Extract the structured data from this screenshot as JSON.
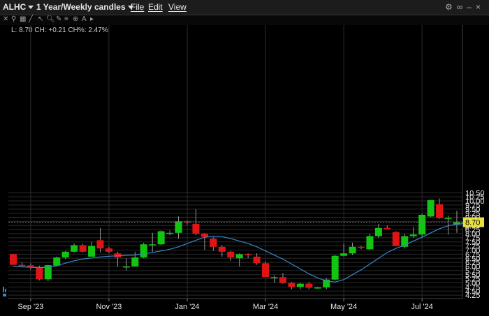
{
  "window": {
    "symbol": "ALHC",
    "period": "1 Year/Weekly candles",
    "menus": [
      "File",
      "Edit",
      "View"
    ]
  },
  "info_line": "L: 8.70 CH: +0.21 CH%: 2.47%",
  "colors": {
    "up": "#11c511",
    "down": "#e01414",
    "ma": "#3a86c8",
    "grid": "#2b2b2b",
    "last_price_bg": "#e8e03c"
  },
  "icons": [
    "settings-icon",
    "link-icon",
    "minimize-icon",
    "close-icon"
  ],
  "chart_data": {
    "type": "candlestick",
    "last_price_label": "8.70",
    "y_ticks": [
      "10.50",
      "10.25",
      "10.00",
      "9.75",
      "9.50",
      "9.25",
      "9.00",
      "8.75",
      "8.50",
      "8.25",
      "8.00",
      "7.75",
      "7.50",
      "7.25",
      "7.00",
      "6.75",
      "6.50",
      "6.25",
      "6.00",
      "5.75",
      "5.50",
      "5.25",
      "5.00",
      "4.75",
      "4.50",
      "4.25"
    ],
    "ylim": [
      4.0,
      10.6
    ],
    "x_labels": [
      {
        "label": "Sep '23",
        "week": 2
      },
      {
        "label": "Nov '23",
        "week": 11
      },
      {
        "label": "Jan '24",
        "week": 20
      },
      {
        "label": "Mar '24",
        "week": 29
      },
      {
        "label": "May '24",
        "week": 38
      },
      {
        "label": "Jul '24",
        "week": 47
      }
    ],
    "candles": [
      [
        6.75,
        6.77,
        6.1,
        6.1
      ],
      [
        6.1,
        6.25,
        5.95,
        6.07
      ],
      [
        6.07,
        6.2,
        5.8,
        5.95
      ],
      [
        5.95,
        6.05,
        5.15,
        5.22
      ],
      [
        5.22,
        6.1,
        5.1,
        6.08
      ],
      [
        6.05,
        6.6,
        6.0,
        6.55
      ],
      [
        6.55,
        6.95,
        6.45,
        6.9
      ],
      [
        6.9,
        7.4,
        6.85,
        7.3
      ],
      [
        7.3,
        7.38,
        6.85,
        6.9
      ],
      [
        6.6,
        7.5,
        6.6,
        7.25
      ],
      [
        7.6,
        8.35,
        6.85,
        7.1
      ],
      [
        7.1,
        7.2,
        6.8,
        6.9
      ],
      [
        6.8,
        6.9,
        6.0,
        6.55
      ],
      [
        6.0,
        6.5,
        5.75,
        6.0
      ],
      [
        6.0,
        6.9,
        5.98,
        6.55
      ],
      [
        6.55,
        7.45,
        6.5,
        7.35
      ],
      [
        7.35,
        8.05,
        6.9,
        7.35
      ],
      [
        7.35,
        8.2,
        7.3,
        8.15
      ],
      [
        8.0,
        8.2,
        7.9,
        8.05
      ],
      [
        8.05,
        9.05,
        7.7,
        8.75
      ],
      [
        8.75,
        8.8,
        8.55,
        8.7
      ],
      [
        8.6,
        9.5,
        7.9,
        8.0
      ],
      [
        8.0,
        8.05,
        7.0,
        7.8
      ],
      [
        7.7,
        7.78,
        6.95,
        7.2
      ],
      [
        7.2,
        7.3,
        6.6,
        6.9
      ],
      [
        6.9,
        6.95,
        6.35,
        6.55
      ],
      [
        6.5,
        6.8,
        6.0,
        6.75
      ],
      [
        6.75,
        6.8,
        6.5,
        6.7
      ],
      [
        6.6,
        6.8,
        6.1,
        6.2
      ],
      [
        6.2,
        6.3,
        5.4,
        5.35
      ],
      [
        5.35,
        5.45,
        5.0,
        5.35
      ],
      [
        5.35,
        5.6,
        4.95,
        5.0
      ],
      [
        5.0,
        5.05,
        4.6,
        4.75
      ],
      [
        4.75,
        5.0,
        4.6,
        4.95
      ],
      [
        4.95,
        5.05,
        4.6,
        4.7
      ],
      [
        4.7,
        4.75,
        4.65,
        4.72
      ],
      [
        4.72,
        5.3,
        4.6,
        5.2
      ],
      [
        5.2,
        6.7,
        5.15,
        6.65
      ],
      [
        6.65,
        7.4,
        6.6,
        6.8
      ],
      [
        6.8,
        7.45,
        6.7,
        7.2
      ],
      [
        7.2,
        7.25,
        7.05,
        7.15
      ],
      [
        7.05,
        8.0,
        7.0,
        7.85
      ],
      [
        7.85,
        8.6,
        7.75,
        8.35
      ],
      [
        8.35,
        8.5,
        8.3,
        8.3
      ],
      [
        8.1,
        8.15,
        7.25,
        7.25
      ],
      [
        7.2,
        8.0,
        7.1,
        7.85
      ],
      [
        7.85,
        8.4,
        7.75,
        7.95
      ],
      [
        7.95,
        9.2,
        7.8,
        9.15
      ],
      [
        9.05,
        10.05,
        9.0,
        10.05
      ],
      [
        9.8,
        10.15,
        8.9,
        8.95
      ],
      [
        8.95,
        9.1,
        7.95,
        8.95
      ],
      [
        8.55,
        9.4,
        8.05,
        8.7
      ],
      [
        8.6,
        8.8,
        8.2,
        8.7
      ]
    ],
    "moving_average": [
      6.0,
      5.98,
      5.95,
      5.93,
      5.95,
      6.05,
      6.2,
      6.35,
      6.45,
      6.52,
      6.58,
      6.62,
      6.65,
      6.68,
      6.7,
      6.78,
      6.85,
      6.95,
      7.05,
      7.2,
      7.4,
      7.6,
      7.78,
      7.85,
      7.82,
      7.7,
      7.55,
      7.4,
      7.2,
      6.95,
      6.7,
      6.45,
      6.15,
      5.85,
      5.55,
      5.3,
      5.12,
      5.05,
      5.2,
      5.5,
      5.8,
      6.15,
      6.5,
      6.85,
      7.1,
      7.3,
      7.55,
      7.78,
      8.05,
      8.3,
      8.48,
      8.58,
      8.62
    ]
  }
}
